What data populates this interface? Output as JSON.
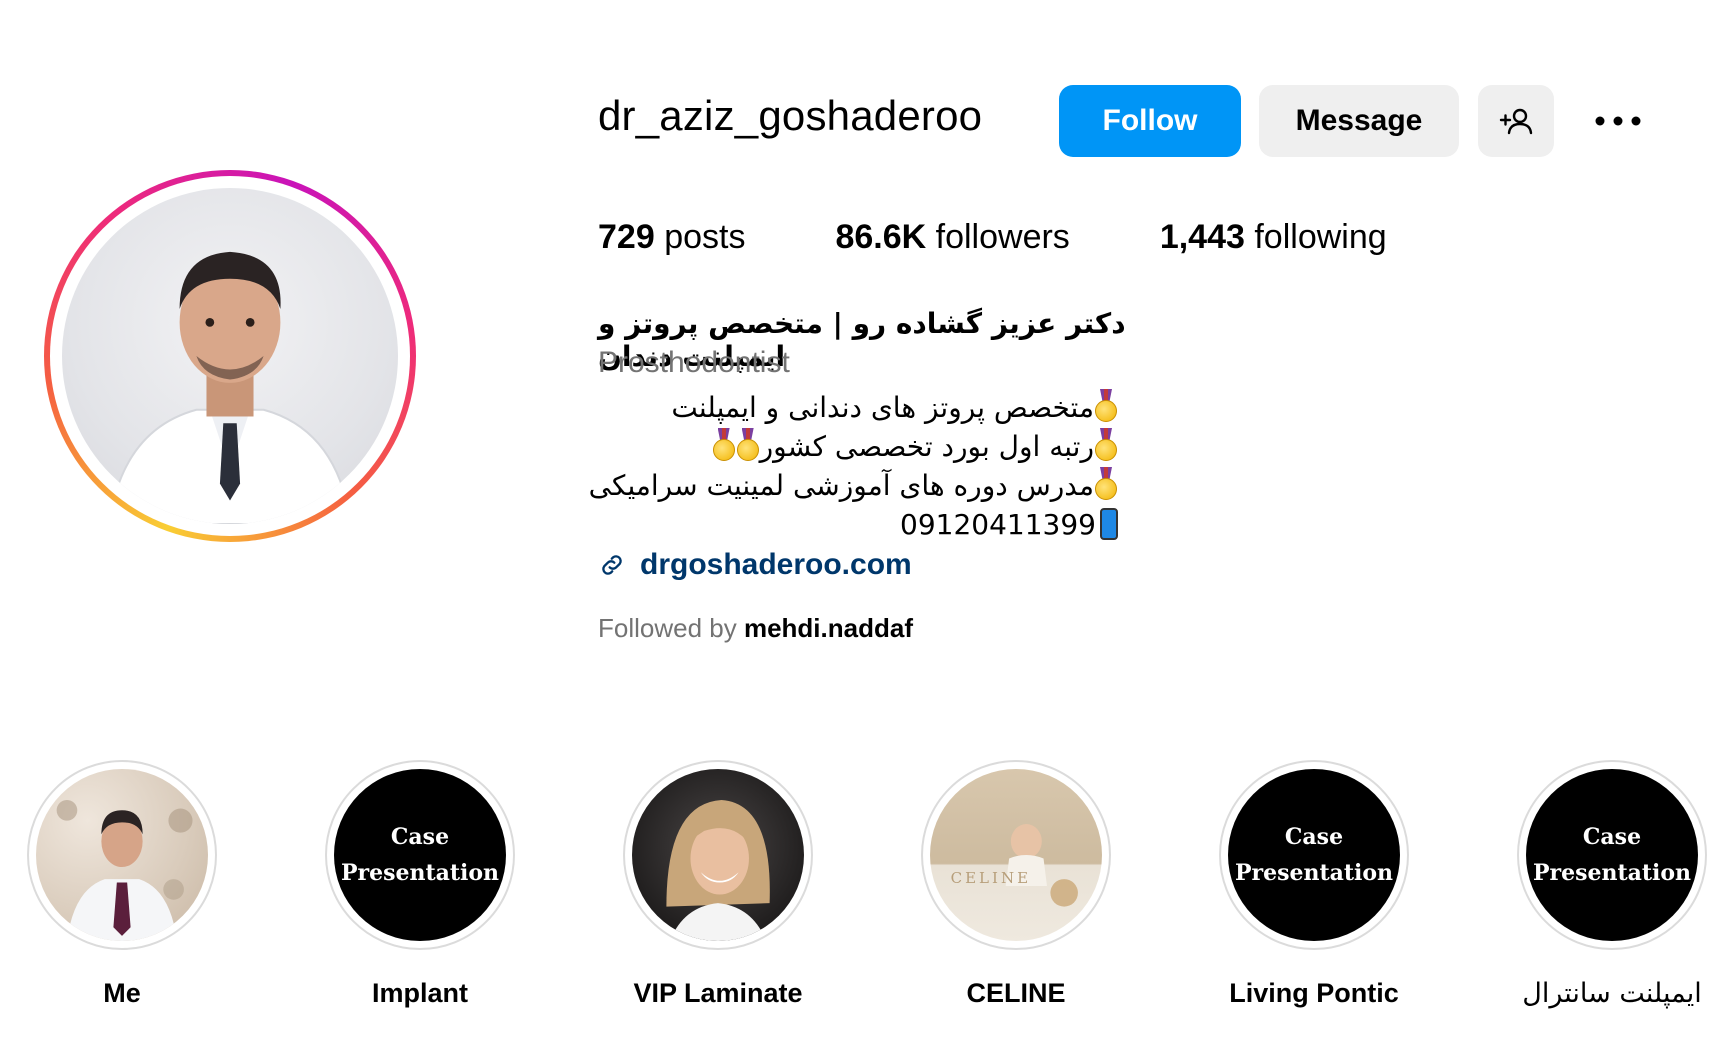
{
  "profile": {
    "username": "dr_aziz_goshaderoo",
    "follow_label": "Follow",
    "message_label": "Message",
    "add_user_icon": "add-user-icon",
    "more_icon": "more-options-icon"
  },
  "stats": {
    "posts_count": "729",
    "posts_label": "posts",
    "followers_count": "86.6K",
    "followers_label": "followers",
    "following_count": "1,443",
    "following_label": "following"
  },
  "bio": {
    "display_name": "دکتر عزیز گشاده رو | متخصص پروتز و ایمپلنت دندان",
    "category": "Prosthodontist",
    "line1": "متخصص پروتز های دندانی و ایمپلنت",
    "line2": "رتبه اول بورد تخصصی کشور",
    "line3": "مدرس دوره های آموزشی لمینیت سرامیکی",
    "line4": "09120411399",
    "link": "drgoshaderoo.com",
    "followed_by_prefix": "Followed by",
    "followed_by_user": "mehdi.naddaf"
  },
  "highlights": [
    {
      "label": "Me"
    },
    {
      "label": "Implant",
      "cover_line1": "Case",
      "cover_line2": "Presentation"
    },
    {
      "label": "VIP Laminate"
    },
    {
      "label": "CELINE",
      "cover_text": "CELINE"
    },
    {
      "label": "Living Pontic",
      "cover_line1": "Case",
      "cover_line2": "Presentation"
    },
    {
      "label": "ایمپلنت سانترال",
      "cover_line1": "Case",
      "cover_line2": "Presentation"
    }
  ],
  "colors": {
    "follow_button": "#0095f6",
    "secondary_button": "#efefef",
    "link": "#00376b",
    "muted_text": "#737373"
  }
}
